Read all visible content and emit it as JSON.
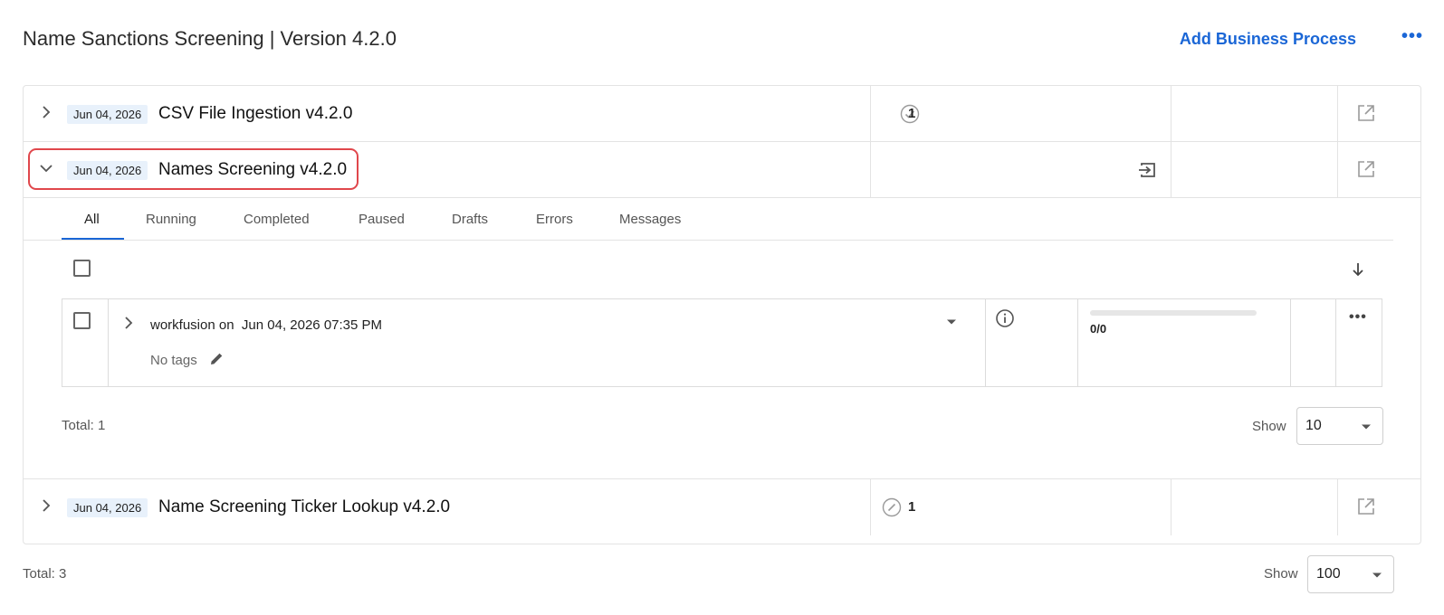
{
  "header": {
    "title": "Name Sanctions Screening | Version 4.2.0",
    "add_button": "Add Business Process",
    "more": "•••"
  },
  "processes": [
    {
      "date": "Jun 04, 2026",
      "name": "CSV File Ingestion v4.2.0",
      "count": "1",
      "status_icon": "check-circle-icon",
      "expanded": false
    },
    {
      "date": "Jun 04, 2026",
      "name": "Names Screening v4.2.0",
      "expanded": true,
      "action_icon": "input-transfer-icon"
    },
    {
      "date": "Jun 04, 2026",
      "name": "Name Screening Ticker Lookup v4.2.0",
      "count": "1",
      "status_icon": "slash-circle-icon",
      "expanded": false
    }
  ],
  "tabs": [
    {
      "label": "All",
      "active": true
    },
    {
      "label": "Running"
    },
    {
      "label": "Completed"
    },
    {
      "label": "Paused"
    },
    {
      "label": "Drafts"
    },
    {
      "label": "Errors"
    },
    {
      "label": "Messages"
    }
  ],
  "instance": {
    "user": "workfusion",
    "on": "on",
    "datetime": "Jun 04, 2026 07:35 PM",
    "tags": "No tags",
    "progress_text": "0/0",
    "progress": 0,
    "more": "•••"
  },
  "inner_footer": {
    "total": "Total: 1",
    "show_label": "Show",
    "show_value": "10"
  },
  "footer": {
    "total": "Total: 3",
    "show_label": "Show",
    "show_value": "100"
  },
  "colors": {
    "accent": "#1a66d6",
    "highlight": "#e0474c",
    "date_badge_bg": "#e8f1fb"
  }
}
